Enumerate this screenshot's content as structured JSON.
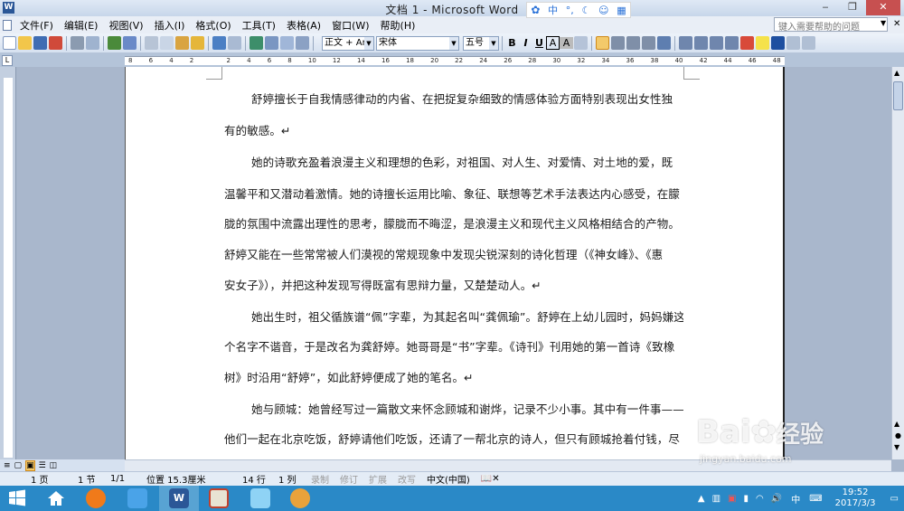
{
  "window": {
    "title": "文档 1 - Microsoft Word",
    "min": "‒",
    "max": "❐",
    "close": "✕"
  },
  "ime": {
    "items": [
      "中",
      "°,",
      "☾",
      "☺",
      "▦"
    ]
  },
  "menu": {
    "items": [
      "文件(F)",
      "编辑(E)",
      "视图(V)",
      "插入(I)",
      "格式(O)",
      "工具(T)",
      "表格(A)",
      "窗口(W)",
      "帮助(H)"
    ],
    "help_placeholder": "键入需要帮助的问题"
  },
  "toolbar": {
    "style": "正文 + Aria",
    "font": "宋体",
    "size": "五号",
    "bold": "B",
    "italic": "I",
    "underline": "U",
    "char_border": "A",
    "char_shade": "A"
  },
  "ruler": {
    "labels": [
      "8",
      "6",
      "4",
      "2",
      "",
      "2",
      "4",
      "6",
      "8",
      "10",
      "12",
      "14",
      "16",
      "18",
      "20",
      "22",
      "24",
      "26",
      "28",
      "30",
      "32",
      "34",
      "36",
      "38",
      "40",
      "42",
      "44",
      "46",
      "48"
    ]
  },
  "document": {
    "paragraphs": [
      "舒婷擅长于自我情感律动的内省、在把捉复杂细致的情感体验方面特别表现出女性独",
      "有的敏感。↵",
      "她的诗歌充盈着浪漫主义和理想的色彩，对祖国、对人生、对爱情、对土地的爱，既",
      "温馨平和又潜动着激情。她的诗擅长运用比喻、象征、联想等艺术手法表达内心感受，在朦",
      "胧的氛围中流露出理性的思考，朦胧而不晦涩，是浪漫主义和现代主义风格相结合的产物。",
      "舒婷又能在一些常常被人们漠视的常规现象中发现尖锐深刻的诗化哲理（《神女峰》、《惠",
      "安女子》），并把这种发现写得既富有思辩力量，又楚楚动人。↵",
      "她出生时，祖父循族谱“佩”字辈，为其起名叫“龚佩瑜”。舒婷在上幼儿园时，妈妈嫌这",
      "个名字不谐音，于是改名为龚舒婷。她哥哥是“书”字辈。《诗刊》刊用她的第一首诗《致橡",
      "树》时沿用“舒婷”，如此舒婷便成了她的笔名。↵",
      "她与顾城：她曾经写过一篇散文来怀念顾城和谢烨，记录不少小事。其中有一件事——",
      "他们一起在北京吃饭，舒婷请他们吃饭，还请了一帮北京的诗人，但只有顾城抢着付钱，尽"
    ]
  },
  "status": {
    "page": "1 页",
    "section": "1 节",
    "pages": "1/1",
    "position": "位置 15.3厘米",
    "line": "14 行",
    "column": "1 列",
    "rec": "录制",
    "trk": "修订",
    "ext": "扩展",
    "ovr": "改写",
    "lang": "中文(中国)"
  },
  "taskbar": {
    "tray_lang": "中",
    "time": "19:52",
    "date": "2017/3/3"
  },
  "watermark": {
    "brand": "Bai",
    "brand2": "经验",
    "url": "jingyan.baidu.com"
  },
  "colors": {
    "taskbar": "#2a89c7",
    "close": "#c75050",
    "canvas": "#a9b7cc"
  }
}
